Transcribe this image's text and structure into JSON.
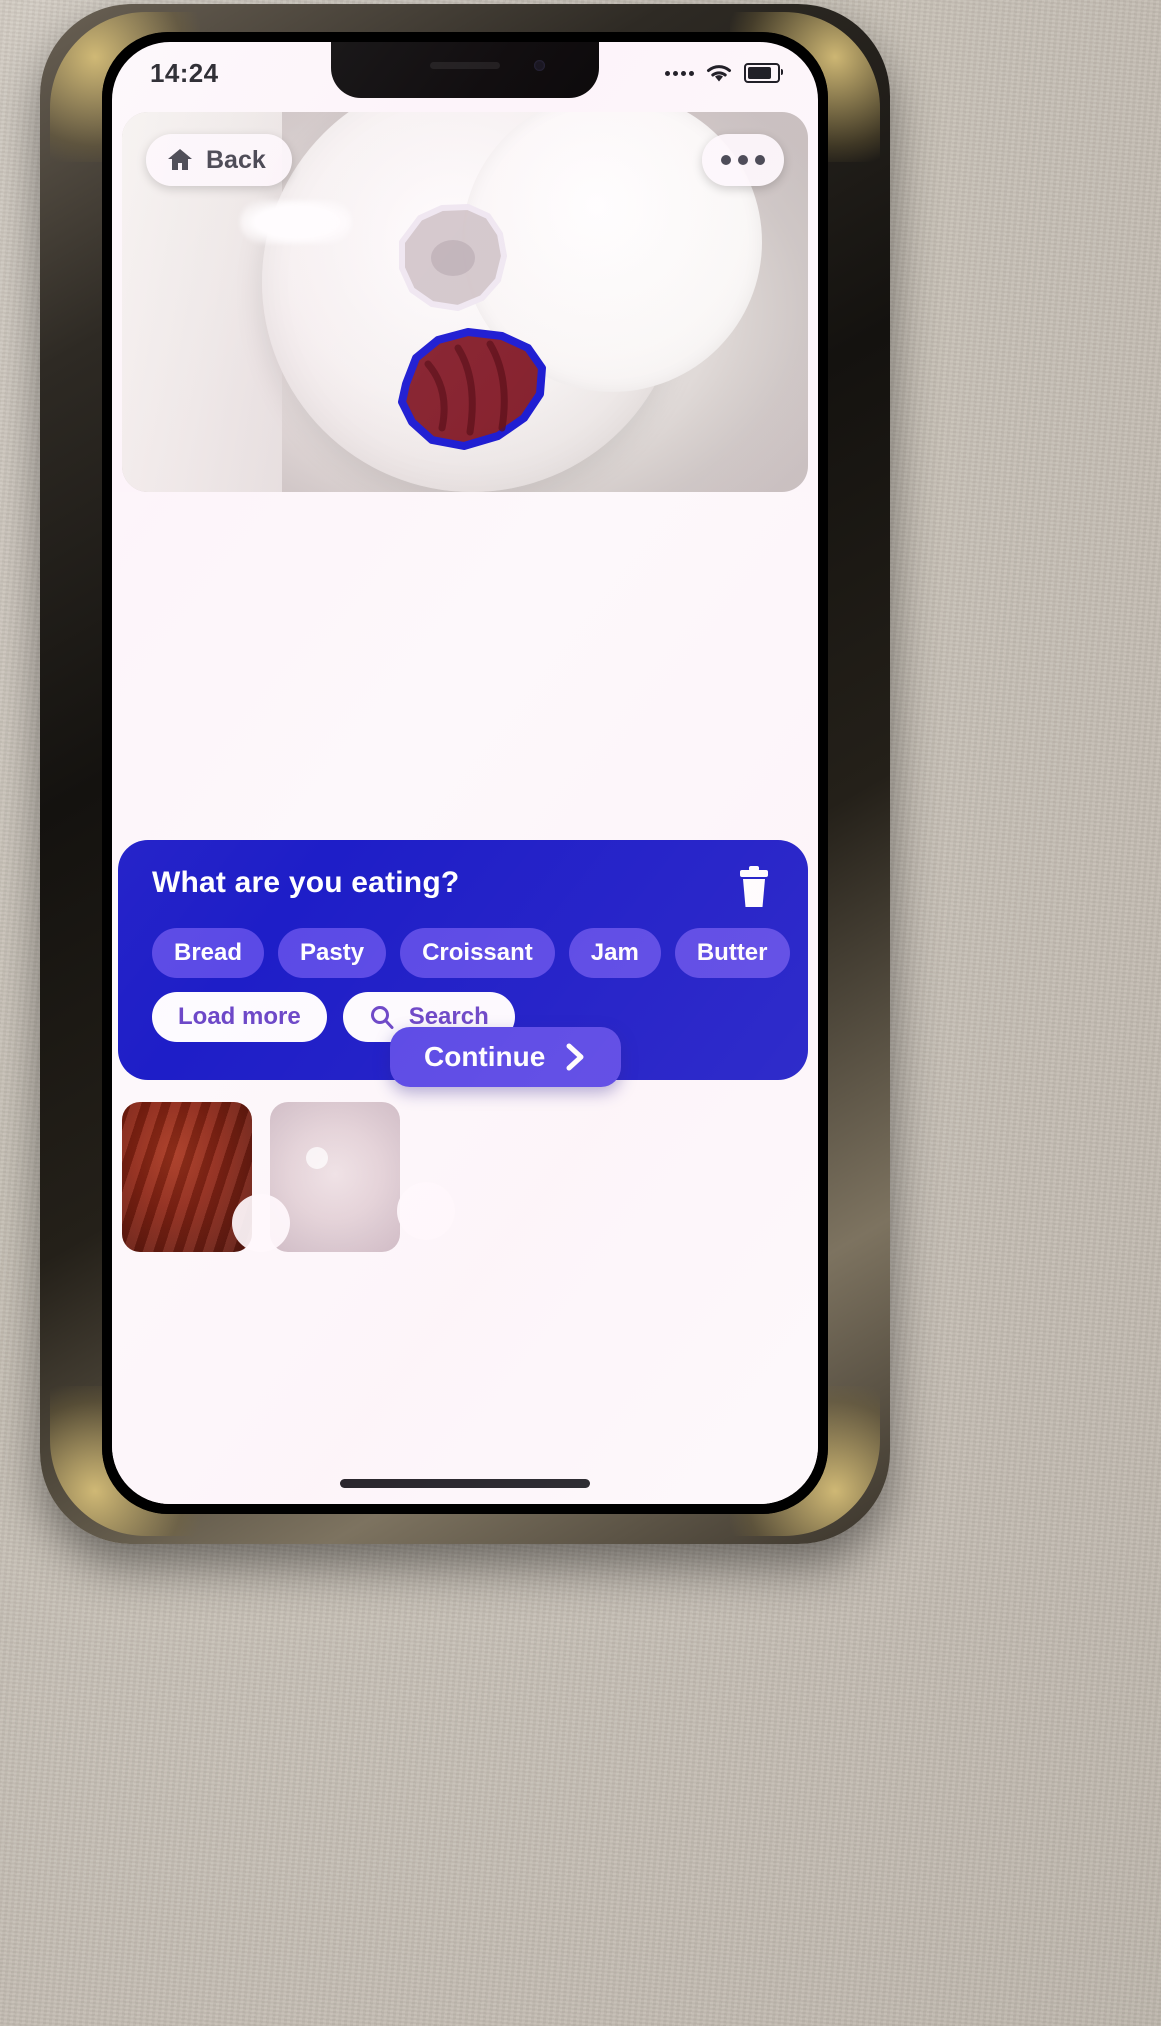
{
  "device": {
    "status_bar": {
      "time": "14:24",
      "signal_icon": "signal-dots-icon",
      "wifi_icon": "wifi-icon",
      "battery_icon": "battery-icon",
      "battery_level": "72"
    },
    "home_indicator": "home-indicator"
  },
  "photo_card": {
    "back_button": {
      "label": "Back",
      "icon": "home-icon"
    },
    "more_button": {
      "icon": "ellipsis-icon",
      "label": "•••"
    },
    "segmentation": [
      {
        "name": "pastry-top",
        "outline_color": "#e8e2ee",
        "selected": "false"
      },
      {
        "name": "croissant-bottom",
        "outline_color": "#1a1ad2",
        "selected": "true"
      }
    ]
  },
  "panel": {
    "title": "What are you eating?",
    "delete_icon": "trash-icon",
    "accent_color": "#1e1ec8",
    "chip_color": "#5b4ae6",
    "tags": [
      "Bread",
      "Pasty",
      "Croissant",
      "Jam",
      "Butter"
    ],
    "actions": [
      {
        "label": "Load more",
        "icon": ""
      },
      {
        "label": "Search",
        "icon": "search-icon"
      }
    ]
  },
  "continue_button": {
    "label": "Continue",
    "icon": "chevron-right-icon"
  },
  "thumbnails": [
    {
      "name": "thumbnail-croissant"
    },
    {
      "name": "thumbnail-donut"
    }
  ]
}
